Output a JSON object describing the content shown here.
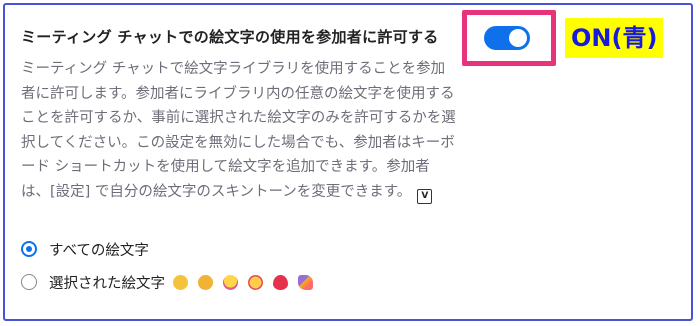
{
  "setting": {
    "title": "ミーティング チャットでの絵文字の使用を参加者に許可する",
    "description": "ミーティング チャットで絵文字ライブラリを使用することを参加者に許可します。参加者にライブラリ内の任意の絵文字を使用することを許可するか、事前に選択された絵文字のみを許可するかを選択してください。この設定を無効にした場合でも、参加者はキーボード ショートカットを使用して絵文字を追加できます。参加者は、[設定] で自分の絵文字のスキントーンを変更できます。",
    "info_icon_glyph": "V",
    "toggle_state": "on"
  },
  "annotation": {
    "label": "ON(青)"
  },
  "options": {
    "all": {
      "label": "すべての絵文字",
      "selected": true
    },
    "selected": {
      "label": "選択された絵文字",
      "selected": false
    }
  },
  "emoji_icons": [
    "clapping-hands",
    "thumbs-up",
    "tears-of-joy",
    "surprised-face",
    "red-heart",
    "party-popper"
  ],
  "colors": {
    "accent": "#0e71eb",
    "highlight_border": "#e8337a",
    "annotation_bg": "#ffff00",
    "annotation_text": "#1a1adb",
    "frame": "#4a53d8"
  }
}
